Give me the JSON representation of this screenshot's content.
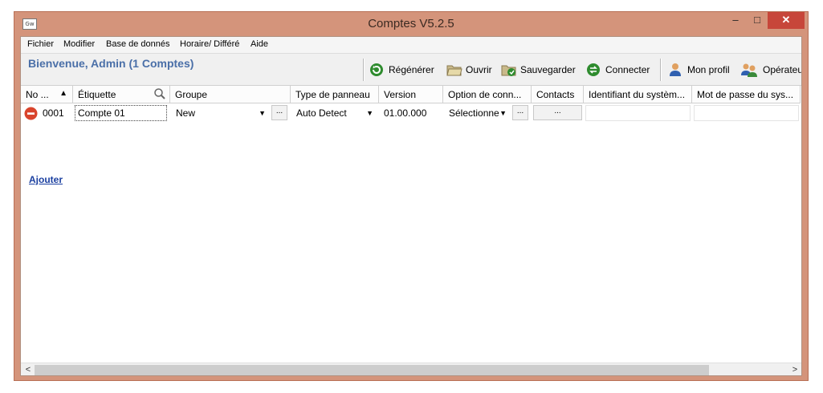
{
  "window": {
    "title": "Comptes V5.2.5",
    "app_icon_text": "Gw",
    "minimize": "–",
    "maximize": "□",
    "close": "✕"
  },
  "menu": [
    {
      "label": "Fichier"
    },
    {
      "label": "Modifier"
    },
    {
      "label": "Base de donnés"
    },
    {
      "label": "Horaire/ Différé"
    },
    {
      "label": "Aide"
    }
  ],
  "toolbar": {
    "welcome": "Bienvenue, Admin  (1 Comptes)",
    "regenerate": "Régénérer",
    "open": "Ouvrir",
    "save": "Sauvegarder",
    "connect": "Connecter",
    "profile": "Mon profil",
    "operators": "Opérateu"
  },
  "columns": {
    "no": "No ...",
    "sort_indicator": "▲",
    "label": "Étiquette",
    "group": "Groupe",
    "panel_type": "Type de panneau",
    "version": "Version",
    "conn_option": "Option de conn...",
    "contacts": "Contacts",
    "system_id": "Identifiant du systèm...",
    "system_pw": "Mot de passe du sys..."
  },
  "row": {
    "no": "0001",
    "label": "Compte 01",
    "group": "New",
    "panel_type": "Auto Detect",
    "version": "01.00.000",
    "conn_option": "Sélectionner",
    "contacts_button": "...",
    "group_button": "...",
    "conn_button": "...",
    "system_id": "",
    "system_pw": ""
  },
  "add_link": "Ajouter",
  "scroll": {
    "left": "<",
    "right": ">"
  }
}
